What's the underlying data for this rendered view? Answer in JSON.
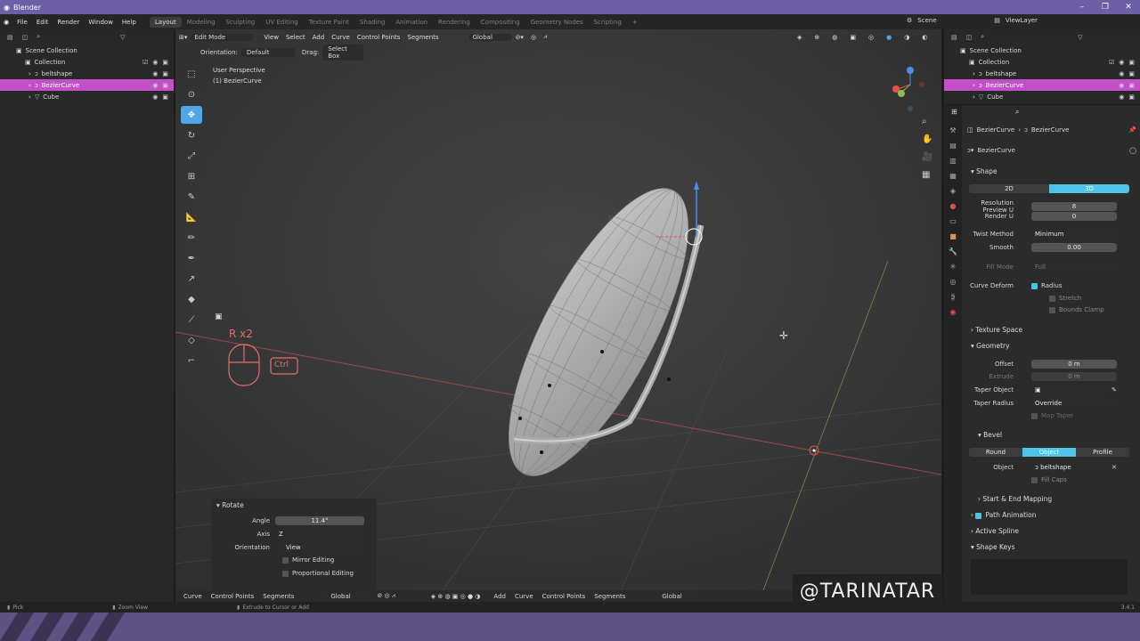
{
  "window": {
    "title": "Blender"
  },
  "menus": [
    "File",
    "Edit",
    "Render",
    "Window",
    "Help"
  ],
  "workspaces": [
    "Layout",
    "Modeling",
    "Sculpting",
    "UV Editing",
    "Texture Paint",
    "Shading",
    "Animation",
    "Rendering",
    "Compositing",
    "Geometry Nodes",
    "Scripting"
  ],
  "top_right": {
    "scene": "Scene",
    "view_layer": "ViewLayer"
  },
  "outliner": {
    "root": "Scene Collection",
    "collection": "Collection",
    "items": [
      "beltshape",
      "BezierCurve",
      "Cube"
    ]
  },
  "viewport": {
    "mode": "Edit Mode",
    "menus": [
      "View",
      "Select",
      "Add",
      "Curve",
      "Control Points",
      "Segments"
    ],
    "orientation_label": "Orientation:",
    "orientation_value": "Default",
    "drag_label": "Drag:",
    "drag_value": "Select Box",
    "transform": "Global",
    "perspective": "User Perspective",
    "object_info": "(1) BezierCurve",
    "key_hint": "R x2",
    "key_ctrl": "Ctrl"
  },
  "operator_panel": {
    "title": "Rotate",
    "angle_label": "Angle",
    "angle_value": "11.4°",
    "axis_label": "Axis",
    "axis_value": "Z",
    "orientation_label": "Orientation",
    "orientation_value": "View",
    "mirror": "Mirror Editing",
    "proportional": "Proportional Editing"
  },
  "bottom_header": {
    "left": [
      "Curve",
      "Control Points",
      "Segments"
    ],
    "global": "Global",
    "mid": [
      "Add",
      "Curve",
      "Control Points",
      "Segments"
    ],
    "global2": "Global"
  },
  "watermark": "@TARINATAR",
  "status": {
    "left": "Pick",
    "mid": "Zoom View",
    "right": "Extrude to Cursor or Add",
    "version": "3.4.1"
  },
  "properties": {
    "breadcrumb_obj": "BezierCurve",
    "breadcrumb_data": "BezierCurve",
    "datablock": "BezierCurve",
    "shape": {
      "title": "Shape",
      "btn2d": "2D",
      "btn3d": "3D",
      "res_u_label": "Resolution Preview U",
      "res_u": "8",
      "render_u_label": "Render U",
      "render_u": "0",
      "twist_label": "Twist Method",
      "twist_value": "Minimum",
      "smooth_label": "Smooth",
      "smooth_value": "0.00",
      "fill_label": "Fill Mode",
      "fill_value": "Full",
      "deform_label": "Curve Deform",
      "radius": "Radius",
      "stretch": "Stretch",
      "bounds": "Bounds Clamp"
    },
    "texture_space": "Texture Space",
    "geometry": {
      "title": "Geometry",
      "offset_label": "Offset",
      "offset": "0 m",
      "extrude_label": "Extrude",
      "extrude": "0 m",
      "taper_label": "Taper Object",
      "taper_radius_label": "Taper Radius",
      "taper_radius": "Override",
      "map_taper": "Map Taper"
    },
    "bevel": {
      "title": "Bevel",
      "round": "Round",
      "object": "Object",
      "profile": "Profile",
      "object_label": "Object",
      "object_value": "beltshape",
      "fill_caps": "Fill Caps"
    },
    "start_end": "Start & End Mapping",
    "path_anim": "Path Animation",
    "active_spline": "Active Spline",
    "shape_keys": "Shape Keys"
  }
}
